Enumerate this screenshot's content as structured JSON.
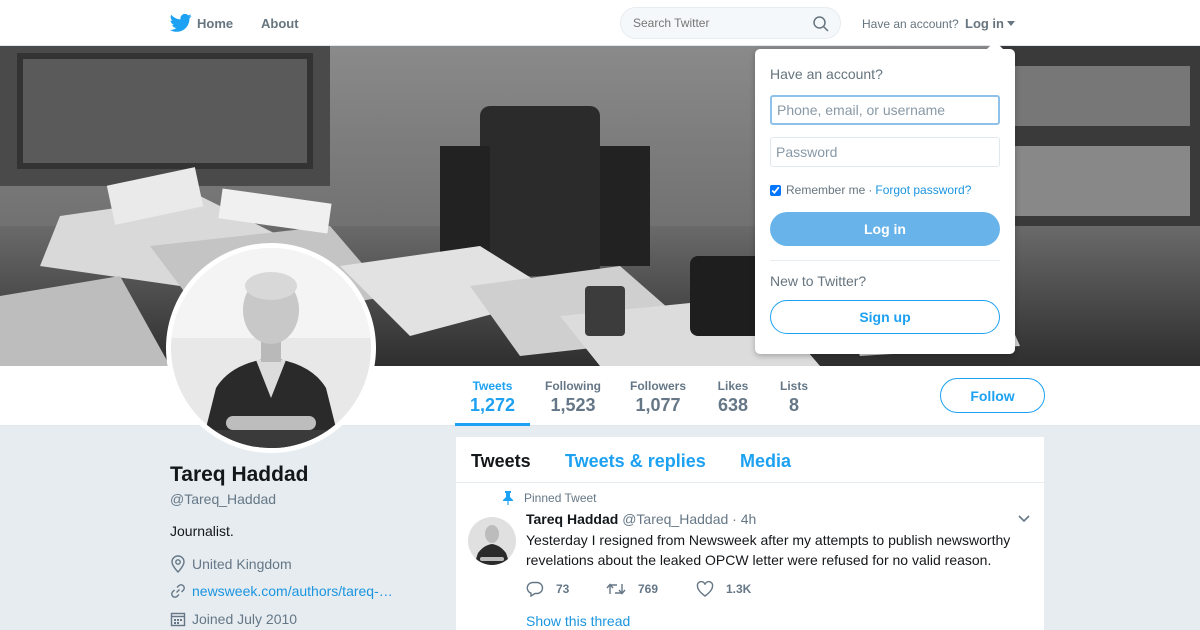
{
  "nav": {
    "home_label": "Home",
    "about_label": "About",
    "search_placeholder": "Search Twitter",
    "have_account": "Have an account?",
    "login_label": "Log in"
  },
  "login_dropdown": {
    "title": "Have an account?",
    "username_placeholder": "Phone, email, or username",
    "password_placeholder": "Password",
    "remember_me": "Remember me",
    "separator": "·",
    "forgot_password": "Forgot password?",
    "login_button": "Log in",
    "new_to_twitter": "New to Twitter?",
    "signup_button": "Sign up"
  },
  "stats": [
    {
      "label": "Tweets",
      "value": "1,272",
      "active": true
    },
    {
      "label": "Following",
      "value": "1,523"
    },
    {
      "label": "Followers",
      "value": "1,077"
    },
    {
      "label": "Likes",
      "value": "638"
    },
    {
      "label": "Lists",
      "value": "8"
    }
  ],
  "follow_button": "Follow",
  "profile": {
    "name": "Tareq Haddad",
    "handle": "@Tareq_Haddad",
    "bio": "Journalist.",
    "location": "United Kingdom",
    "url": "newsweek.com/authors/tareq-…",
    "joined": "Joined July 2010"
  },
  "timeline": {
    "tabs": [
      "Tweets",
      "Tweets & replies",
      "Media"
    ],
    "pinned_label": "Pinned Tweet",
    "tweet": {
      "name": "Tareq Haddad",
      "handle": "@Tareq_Haddad",
      "dot": "·",
      "time": "4h",
      "text": "Yesterday I resigned from Newsweek after my attempts to publish newsworthy revelations about the leaked OPCW letter were refused for no valid reason.",
      "replies": "73",
      "retweets": "769",
      "likes": "1.3K",
      "show_thread": "Show this thread"
    }
  },
  "colors": {
    "accent": "#1da1f2",
    "link": "#1b95e0",
    "muted": "#657786",
    "background": "#e6ecf0"
  }
}
